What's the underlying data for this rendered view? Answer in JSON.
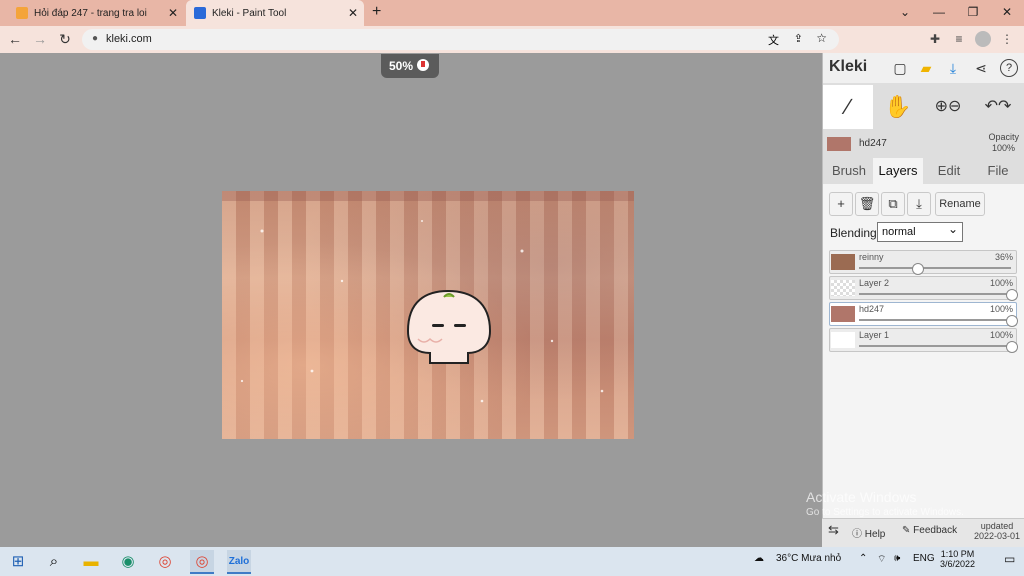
{
  "browser": {
    "tabs": [
      {
        "title": "Hỏi đáp 247 - trang tra loi",
        "close": "✕",
        "fav_color": "#f4a43a"
      },
      {
        "title": "Kleki - Paint Tool",
        "close": "✕",
        "fav_color": "#2a6ad9"
      }
    ],
    "new_tab": "+",
    "window_controls": [
      "⌄",
      "—",
      "❐",
      "✕"
    ],
    "url": "kleki.com",
    "nav": {
      "back": "←",
      "forward": "→",
      "reload": "↻",
      "lock": "🔒"
    },
    "toolbar_icons": [
      "translate-icon",
      "share-icon",
      "star-icon",
      "extensions-icon",
      "reading-list-icon",
      "profile-icon",
      "menu-icon"
    ]
  },
  "canvas": {
    "zoom": "50%"
  },
  "kleki": {
    "logo": "Kleki",
    "header_icons": [
      "new-file-icon",
      "open-folder-icon",
      "download-icon",
      "share-icon",
      "help-icon"
    ],
    "tools": [
      "brush-icon",
      "hand-icon",
      "zoom-icon",
      "undo-redo-icon"
    ],
    "current_layer": {
      "name": "hd247",
      "opacity_label": "Opacity",
      "opacity_value": "100%"
    },
    "tabs": [
      "Brush",
      "Layers",
      "Edit",
      "File"
    ],
    "active_tab": "Layers",
    "layer_buttons": [
      "+",
      "🗑",
      "⧉",
      "⤓"
    ],
    "rename_label": "Rename",
    "blending_label": "Blending",
    "blending_value": "normal",
    "layers": [
      {
        "name": "reinny",
        "opacity": "36%",
        "level": 0.36,
        "active": false
      },
      {
        "name": "Layer 2",
        "opacity": "100%",
        "level": 1.0,
        "active": false
      },
      {
        "name": "hd247",
        "opacity": "100%",
        "level": 1.0,
        "active": true
      },
      {
        "name": "Layer 1",
        "opacity": "100%",
        "level": 1.0,
        "active": false
      }
    ],
    "footer": {
      "help": "Help",
      "feedback": "Feedback",
      "updated": "updated",
      "date": "2022-03-01"
    }
  },
  "watermark": {
    "line1": "Activate Windows",
    "line2": "Go to Settings to activate Windows."
  },
  "taskbar": {
    "weather": "36°C  Mưa nhỏ",
    "lang": "ENG",
    "time": "1:10 PM",
    "date": "3/6/2022"
  }
}
